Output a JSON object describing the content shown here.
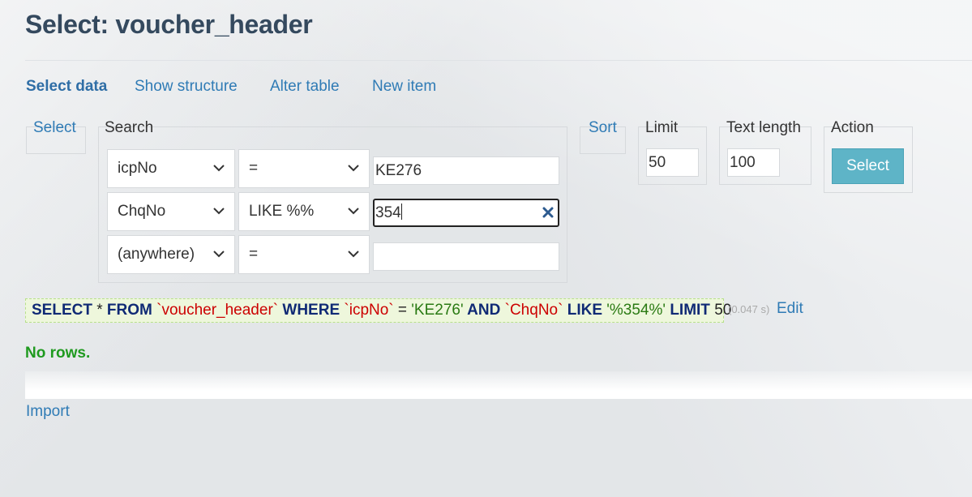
{
  "page": {
    "title": "Select: voucher_header"
  },
  "nav": {
    "select_data": "Select data",
    "show_structure": "Show structure",
    "alter_table": "Alter table",
    "new_item": "New item"
  },
  "fieldsets": {
    "select": "Select",
    "search": "Search",
    "sort": "Sort",
    "limit": "Limit",
    "text_length": "Text length",
    "action": "Action"
  },
  "search_rows": [
    {
      "column": "icpNo",
      "operator": "=",
      "value": "KE276"
    },
    {
      "column": "ChqNo",
      "operator": "LIKE %%",
      "value": "354"
    },
    {
      "column": "(anywhere)",
      "operator": "=",
      "value": ""
    }
  ],
  "limit_value": "50",
  "text_length_value": "100",
  "action_button": "Select",
  "query": {
    "t1": "SELECT",
    "t2": " * ",
    "t3": "FROM",
    "t4": " `voucher_header` ",
    "t5": "WHERE",
    "t6": " `icpNo` ",
    "t7": "= ",
    "t8": "'KE276'",
    "t9": " AND",
    "t10": " `ChqNo` ",
    "t11": "LIKE",
    "t12": " '%354%' ",
    "t13": "LIMIT",
    "t14": " 50",
    "time": "(0.047 s)",
    "edit": "Edit"
  },
  "result": {
    "message": "No rows."
  },
  "footer": {
    "import": "Import"
  },
  "colors": {
    "link": "#2f7bb5",
    "heading": "#34495e",
    "button": "#5eb4c7",
    "success": "#1f9a1f",
    "keyword": "#102a75",
    "identifier": "#cc0000",
    "string": "#2a7a13"
  },
  "icons": [
    "chevron-down-icon",
    "clear-icon"
  ]
}
